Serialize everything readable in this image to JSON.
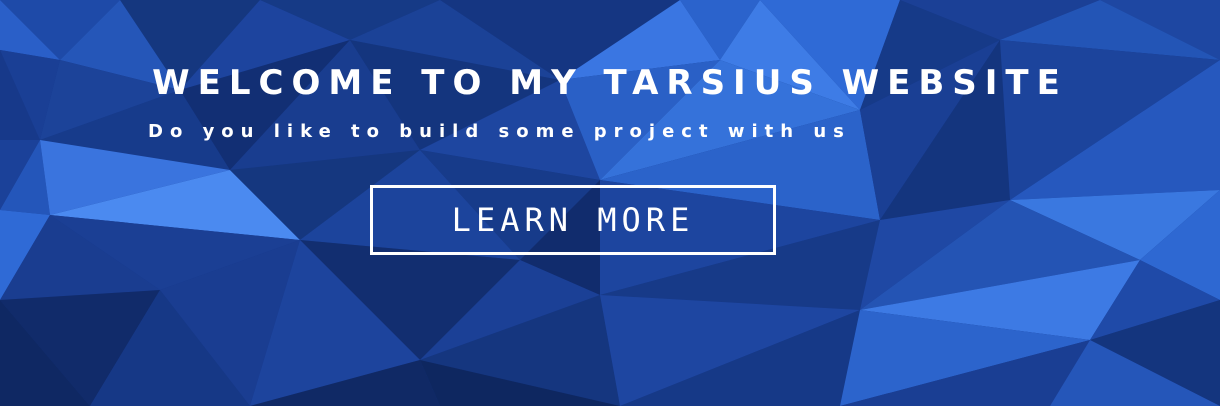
{
  "colors": {
    "background_base": "#17398a",
    "background_light": "#2f6ad6",
    "background_dark": "#0d2356",
    "text": "#ffffff"
  },
  "hero": {
    "headline": "WELCOME TO MY TARSIUS WEBSITE",
    "subheadline": "Do you like to build some project with us",
    "button_label": "LEARN MORE"
  }
}
